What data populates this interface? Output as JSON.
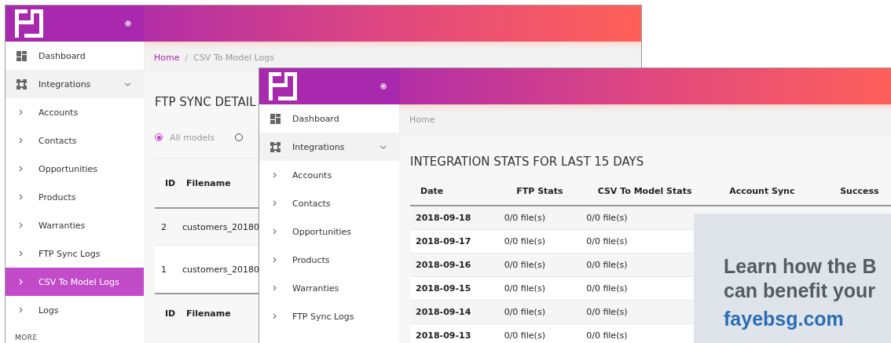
{
  "back_window": {
    "sidebar": {
      "items": [
        {
          "label": "Dashboard",
          "kind": "page",
          "selected": false
        },
        {
          "label": "Integrations",
          "kind": "group",
          "expanded": true,
          "selected": false
        },
        {
          "label": "Accounts",
          "kind": "sub",
          "selected": false
        },
        {
          "label": "Contacts",
          "kind": "sub",
          "selected": false
        },
        {
          "label": "Opportunities",
          "kind": "sub",
          "selected": false
        },
        {
          "label": "Products",
          "kind": "sub",
          "selected": false
        },
        {
          "label": "Warranties",
          "kind": "sub",
          "selected": false
        },
        {
          "label": "FTP Sync Logs",
          "kind": "sub",
          "selected": false
        },
        {
          "label": "CSV To Model Logs",
          "kind": "sub",
          "selected": true
        },
        {
          "label": "Logs",
          "kind": "sub",
          "selected": false
        }
      ],
      "section_label": "MORE"
    },
    "breadcrumb": [
      {
        "label": "Home",
        "current": false
      },
      {
        "label": "CSV To Model Logs",
        "current": true
      }
    ],
    "breadcrumb_separator": "/",
    "heading": "FTP SYNC DETAIL",
    "radios": [
      {
        "label": "All models",
        "selected": true
      },
      {
        "selected": false
      }
    ],
    "table": {
      "columns": [
        "ID",
        "Filename"
      ],
      "rows": [
        [
          "2",
          "customers_20180"
        ],
        [
          "1",
          "customers_20180"
        ]
      ],
      "footer_columns": [
        "ID",
        "Filename"
      ]
    }
  },
  "front_window": {
    "sidebar": {
      "items": [
        {
          "label": "Dashboard",
          "kind": "page",
          "selected": false
        },
        {
          "label": "Integrations",
          "kind": "group",
          "expanded": true,
          "selected": false
        },
        {
          "label": "Accounts",
          "kind": "sub",
          "selected": false
        },
        {
          "label": "Contacts",
          "kind": "sub",
          "selected": false
        },
        {
          "label": "Opportunities",
          "kind": "sub",
          "selected": false
        },
        {
          "label": "Products",
          "kind": "sub",
          "selected": false
        },
        {
          "label": "Warranties",
          "kind": "sub",
          "selected": false
        },
        {
          "label": "FTP Sync Logs",
          "kind": "sub",
          "selected": false
        }
      ]
    },
    "breadcrumb": [
      {
        "label": "Home",
        "current": true
      }
    ],
    "heading": "INTEGRATION STATS FOR LAST 15 DAYS",
    "table": {
      "columns": [
        "Date",
        "FTP Stats",
        "CSV To Model Stats",
        "Account Sync",
        "Success"
      ],
      "rows": [
        [
          "2018-09-18",
          "0/0 file(s)",
          "0/0 file(s)"
        ],
        [
          "2018-09-17",
          "0/0 file(s)",
          "0/0 file(s)"
        ],
        [
          "2018-09-16",
          "0/0 file(s)",
          "0/0 file(s)"
        ],
        [
          "2018-09-15",
          "0/0 file(s)",
          "0/0 file(s)"
        ],
        [
          "2018-09-14",
          "0/0 file(s)",
          "0/0 file(s)"
        ],
        [
          "2018-09-13",
          "0/0 file(s)",
          "0/0 file(s)"
        ]
      ]
    },
    "ad": {
      "lines": [
        "Learn how the B",
        "can benefit your"
      ],
      "link": "fayebsg.com"
    }
  }
}
